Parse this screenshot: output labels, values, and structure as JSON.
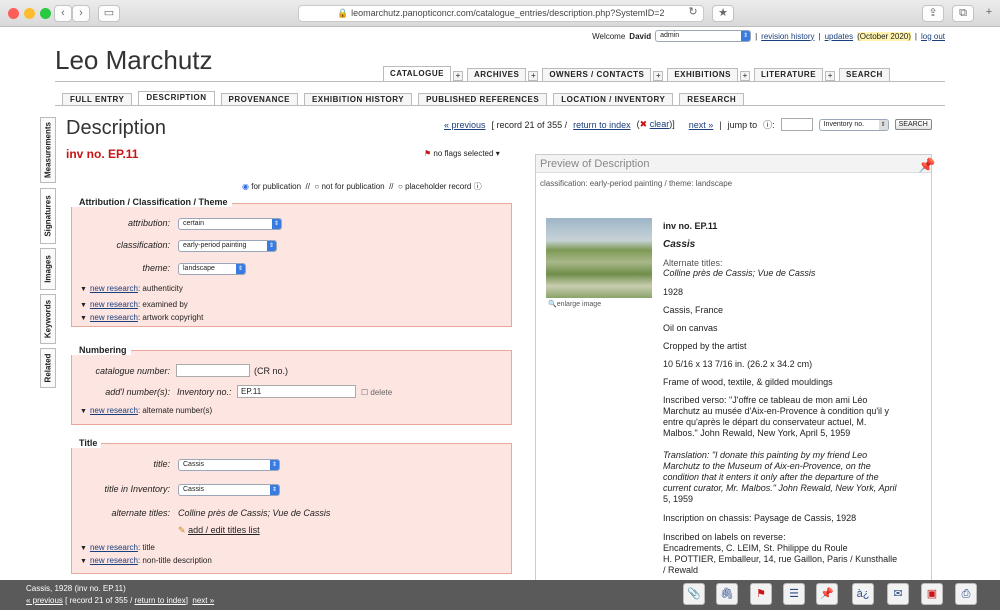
{
  "browser": {
    "url": "leomarchutz.panopticoncr.com/catalogue_entries/description.php?SystemID=2"
  },
  "header": {
    "welcome": "Welcome",
    "user": "David",
    "role": "admin",
    "revision": "revision history",
    "updates": "updates",
    "updates_date": "(October 2020)",
    "logout": "log out"
  },
  "site_title": "Leo Marchutz",
  "main_tabs": [
    "CATALOGUE",
    "ARCHIVES",
    "OWNERS / CONTACTS",
    "EXHIBITIONS",
    "LITERATURE",
    "SEARCH"
  ],
  "sub_tabs": [
    "FULL ENTRY",
    "DESCRIPTION",
    "PROVENANCE",
    "EXHIBITION HISTORY",
    "PUBLISHED REFERENCES",
    "LOCATION / INVENTORY",
    "RESEARCH"
  ],
  "side_tabs": [
    "Measurements",
    "Signatures",
    "Images",
    "Keywords",
    "Related"
  ],
  "page": {
    "heading": "Description",
    "inv": "inv no. EP.11",
    "flags": "no flags selected",
    "nav": {
      "prev": "« previous",
      "record": "[ record 21 of 355 /",
      "return": "return to index",
      "clear": "clear",
      "close": ")]",
      "next": "next »",
      "jump": "jump to",
      "jump_select": "Inventory no.",
      "search_btn": "SEARCH"
    },
    "pub": {
      "for": "for publication",
      "not": "not for publication",
      "placeholder": "placeholder record",
      "sep": "//"
    }
  },
  "attribution": {
    "title": "Attribution / Classification / Theme",
    "attribution_label": "attribution:",
    "attribution_val": "certain",
    "classification_label": "classification:",
    "classification_val": "early-period painting",
    "theme_label": "theme:",
    "theme_val": "landscape",
    "nr": [
      {
        "link": "new research",
        "text": ": authenticity"
      },
      {
        "link": "new research",
        "text": ": examined by"
      },
      {
        "link": "new research",
        "text": ": artwork copyright"
      }
    ]
  },
  "numbering": {
    "title": "Numbering",
    "cat_label": "catalogue number:",
    "cr": "(CR no.)",
    "addl_label": "add'l number(s):",
    "inv_label": "Inventory no.:",
    "inv_val": "EP.11",
    "delete": "delete",
    "nr_link": "new research",
    "nr_text": ": alternate number(s)"
  },
  "title_sec": {
    "title": "Title",
    "title_label": "title:",
    "title_val": "Cassis",
    "inv_label": "title in Inventory:",
    "inv_val": "Cassis",
    "alt_label": "alternate titles:",
    "alt_val": "Colline près de Cassis; Vue de Cassis",
    "add": "add / edit titles list",
    "nr": [
      {
        "link": "new research",
        "text": ": title"
      },
      {
        "link": "new research",
        "text": ": non-title description"
      }
    ]
  },
  "preview": {
    "title": "Preview of Description",
    "meta": "classification: early-period painting   /   theme: landscape",
    "enlarge": "enlarge image",
    "lines": [
      "inv no. EP.11",
      "Cassis",
      "Alternate titles:",
      "Colline près de Cassis; Vue de Cassis",
      "1928",
      "Cassis, France",
      "Oil on canvas",
      "Cropped by the artist",
      "10 5/16 x 13 7/16 in. (26.2 x 34.2 cm)",
      "Frame of wood, textile, & gilded mouldings",
      "Inscribed verso: \"J'offre ce tableau de mon ami Léo",
      "Marchutz au musée d'Aix-en-Provence à condition qu'il y",
      "entre qu'après le départ du conservateur actuel, M.",
      "Malbos.\" John Rewald, New York, April 5, 1959",
      "Translation: \"I donate this painting by my friend Leo",
      "Marchutz to the Museum of Aix-en-Provence, on the",
      "condition that it enters it only after the departure of the",
      "current curator, Mr. Malbos.\" John Rewald, New York, April",
      "5, 1959",
      "Inscription on chassis: Paysage de Cassis, 1928",
      "Inscribed on labels on reverse:",
      "Encadrements, C. LEIM, St. Philippe du Roule",
      "H. POTTIER, Emballeur, 14, rue Gaillon, Paris / Kunsthalle",
      "/ Rewald"
    ]
  },
  "footer": {
    "caption": "Cassis, 1928 (inv no. EP.11)",
    "prev": "« previous",
    "record": "[ record 21 of 355 /",
    "return": "return to index",
    "close": "]",
    "next": "next »"
  },
  "colors": {
    "accent": "#c81414",
    "section_bg": "#fde5e1",
    "footer": "#5a5a5a"
  }
}
